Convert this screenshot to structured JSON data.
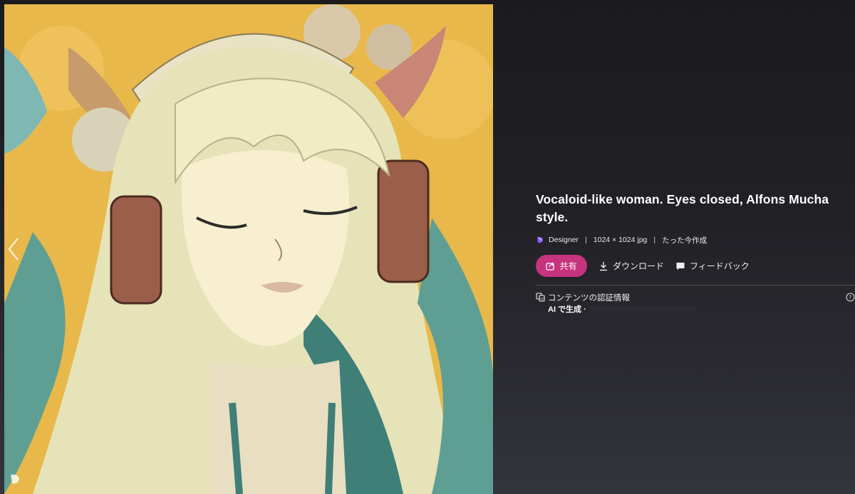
{
  "image": {
    "alt_icon": "artwork-image",
    "prev_icon": "chevron-left-icon",
    "logo_icon": "designer-logo-icon"
  },
  "info": {
    "title": "Vocaloid-like woman. Eyes closed, Alfons Mucha style.",
    "meta": {
      "source_icon": "designer-icon",
      "source": "Designer",
      "separator": "|",
      "dimensions": "1024 × 1024 jpg",
      "created": "たった今作成"
    },
    "actions": {
      "share_label": "共有",
      "download_label": "ダウンロード",
      "feedback_label": "フィードバック"
    },
    "credentials": {
      "label": "コンテンツの認証情報",
      "ai_generated": "AI で生成 ·"
    }
  },
  "colors": {
    "accent": "#c8337f",
    "background": "#1c1b1e",
    "image_bg": "#e8b84a"
  }
}
